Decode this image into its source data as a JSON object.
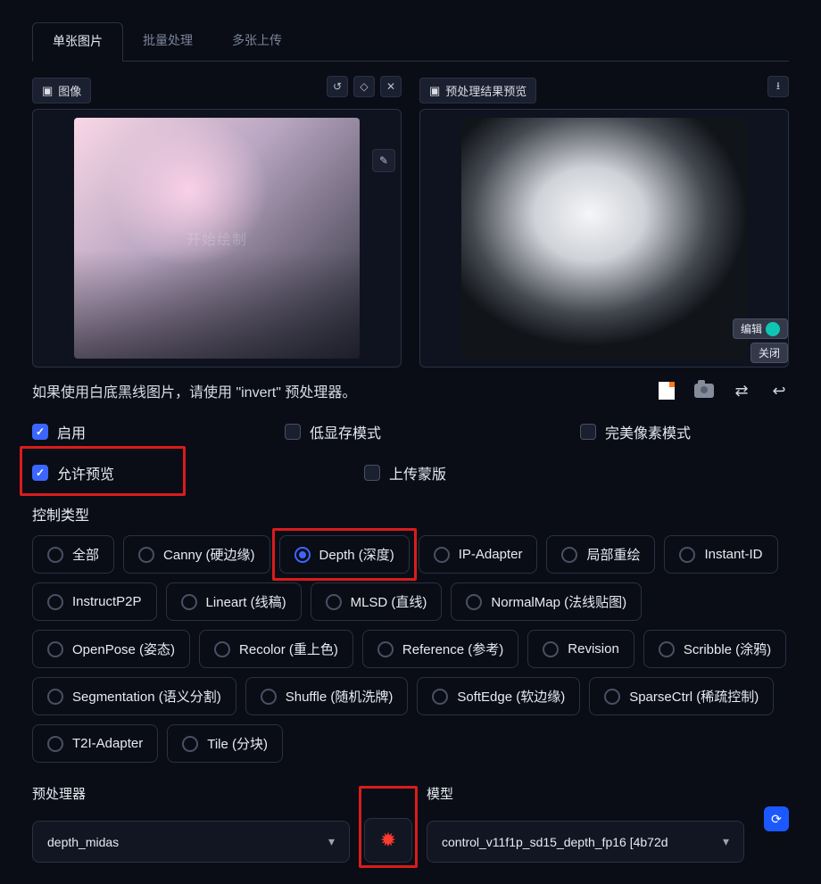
{
  "tabs": {
    "single": "单张图片",
    "batch": "批量处理",
    "multi": "多张上传"
  },
  "image_left": {
    "title": "图像",
    "overlay": "开始绘制"
  },
  "image_right": {
    "title": "预处理结果预览",
    "edit": "编辑",
    "close": "关闭"
  },
  "hint": "如果使用白底黑线图片，请使用 \"invert\" 预处理器。",
  "checks": {
    "enable": "启用",
    "lowvram": "低显存模式",
    "pixel_perfect": "完美像素模式",
    "allow_preview": "允许预览",
    "upload_mask": "上传蒙版"
  },
  "control_type_title": "控制类型",
  "control_types": [
    {
      "label": "全部",
      "selected": false
    },
    {
      "label": "Canny (硬边缘)",
      "selected": false
    },
    {
      "label": "Depth (深度)",
      "selected": true
    },
    {
      "label": "IP-Adapter",
      "selected": false
    },
    {
      "label": "局部重绘",
      "selected": false
    },
    {
      "label": "Instant-ID",
      "selected": false
    },
    {
      "label": "InstructP2P",
      "selected": false
    },
    {
      "label": "Lineart (线稿)",
      "selected": false
    },
    {
      "label": "MLSD (直线)",
      "selected": false
    },
    {
      "label": "NormalMap (法线贴图)",
      "selected": false
    },
    {
      "label": "OpenPose (姿态)",
      "selected": false
    },
    {
      "label": "Recolor (重上色)",
      "selected": false
    },
    {
      "label": "Reference (参考)",
      "selected": false
    },
    {
      "label": "Revision",
      "selected": false
    },
    {
      "label": "Scribble (涂鸦)",
      "selected": false
    },
    {
      "label": "Segmentation (语义分割)",
      "selected": false
    },
    {
      "label": "Shuffle (随机洗牌)",
      "selected": false
    },
    {
      "label": "SoftEdge (软边缘)",
      "selected": false
    },
    {
      "label": "SparseCtrl (稀疏控制)",
      "selected": false
    },
    {
      "label": "T2I-Adapter",
      "selected": false
    },
    {
      "label": "Tile (分块)",
      "selected": false
    }
  ],
  "preprocessor": {
    "label": "预处理器",
    "value": "depth_midas"
  },
  "model": {
    "label": "模型",
    "value": "control_v11f1p_sd15_depth_fp16 [4b72d"
  }
}
